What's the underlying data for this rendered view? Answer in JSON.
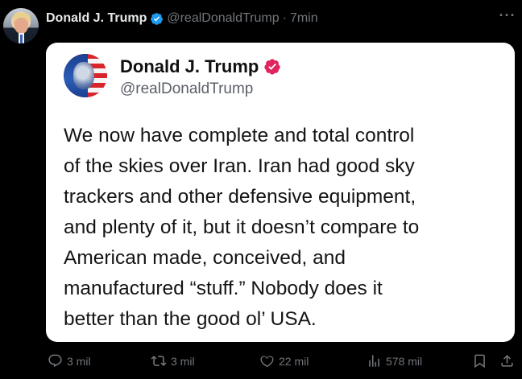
{
  "post": {
    "author_name": "Donald J. Trump",
    "author_handle": "@realDonaldTrump",
    "separator": "·",
    "time": "7min",
    "more_icon": "more-horizontal-icon",
    "verified_color": "#1d9bf0"
  },
  "embedded": {
    "author_name": "Donald J. Trump",
    "author_handle": "@realDonaldTrump",
    "verified_color": "#e0245e",
    "text_lines": [
      "We now have complete and total control",
      "of the skies over Iran. Iran had good sky",
      "trackers and other defensive equipment,",
      "and plenty of it, but it doesn’t compare to",
      "American made, conceived, and",
      "manufactured “stuff.” Nobody does it",
      "better than the good ol’ USA."
    ]
  },
  "actions": {
    "reply": {
      "icon": "reply-icon",
      "count": "3 mil"
    },
    "repost": {
      "icon": "repost-icon",
      "count": "3 mil"
    },
    "like": {
      "icon": "heart-icon",
      "count": "22 mil"
    },
    "views": {
      "icon": "views-icon",
      "count": "578 mil"
    },
    "bookmark": {
      "icon": "bookmark-icon"
    },
    "share": {
      "icon": "share-icon"
    }
  },
  "colors": {
    "background": "#000000",
    "primary_text": "#e7e9ea",
    "secondary_text": "#71767b",
    "card_background": "#ffffff"
  }
}
